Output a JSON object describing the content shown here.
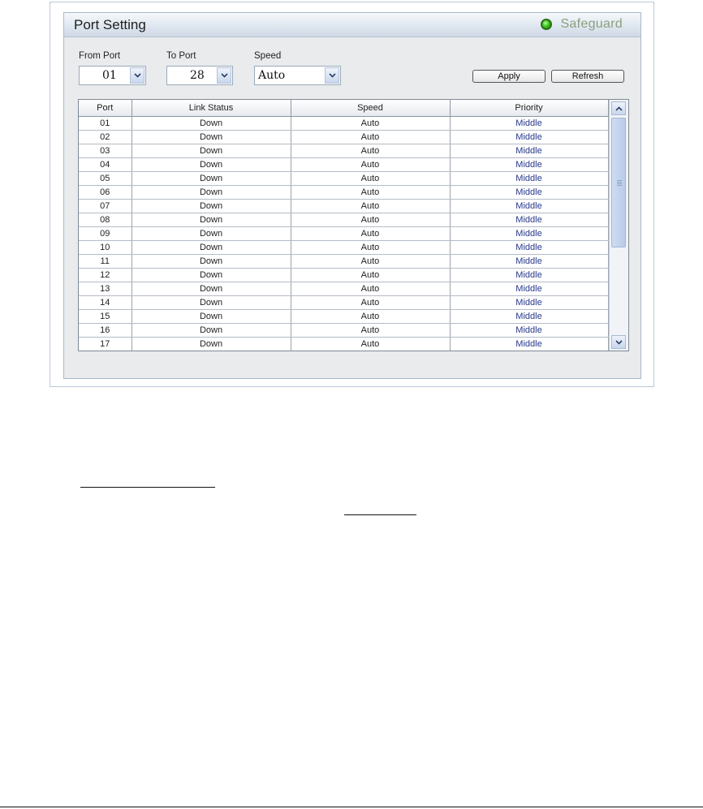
{
  "panel": {
    "title": "Port Setting",
    "safeguard_label": "Safeguard"
  },
  "controls": {
    "from_port_label": "From Port",
    "from_port_value": "01",
    "to_port_label": "To Port",
    "to_port_value": "28",
    "speed_label": "Speed",
    "speed_value": "Auto",
    "apply_label": "Apply",
    "refresh_label": "Refresh"
  },
  "table": {
    "headers": [
      "Port",
      "Link Status",
      "Speed",
      "Priority"
    ],
    "rows": [
      [
        "01",
        "Down",
        "Auto",
        "Middle"
      ],
      [
        "02",
        "Down",
        "Auto",
        "Middle"
      ],
      [
        "03",
        "Down",
        "Auto",
        "Middle"
      ],
      [
        "04",
        "Down",
        "Auto",
        "Middle"
      ],
      [
        "05",
        "Down",
        "Auto",
        "Middle"
      ],
      [
        "06",
        "Down",
        "Auto",
        "Middle"
      ],
      [
        "07",
        "Down",
        "Auto",
        "Middle"
      ],
      [
        "08",
        "Down",
        "Auto",
        "Middle"
      ],
      [
        "09",
        "Down",
        "Auto",
        "Middle"
      ],
      [
        "10",
        "Down",
        "Auto",
        "Middle"
      ],
      [
        "11",
        "Down",
        "Auto",
        "Middle"
      ],
      [
        "12",
        "Down",
        "Auto",
        "Middle"
      ],
      [
        "13",
        "Down",
        "Auto",
        "Middle"
      ],
      [
        "14",
        "Down",
        "Auto",
        "Middle"
      ],
      [
        "15",
        "Down",
        "Auto",
        "Middle"
      ],
      [
        "16",
        "Down",
        "Auto",
        "Middle"
      ],
      [
        "17",
        "Down",
        "Auto",
        "Middle"
      ]
    ]
  },
  "icons": {
    "safeguard": "safeguard-status-icon",
    "dropdown": "chevron-down-icon",
    "scroll_up": "chevron-up-icon",
    "scroll_down": "chevron-down-icon"
  },
  "colors": {
    "priority_text": "#27398c",
    "safeguard_green": "#3ec71c"
  }
}
